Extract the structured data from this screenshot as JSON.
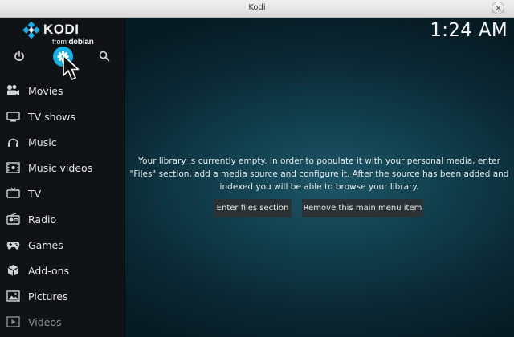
{
  "window": {
    "title": "Kodi"
  },
  "logo": {
    "name": "KODI",
    "from": "from",
    "distro": "debian"
  },
  "top_icons": [
    "power-icon",
    "settings-gear-icon",
    "search-icon"
  ],
  "clock": "1:24 AM",
  "menu": {
    "items": [
      {
        "label": "Movies",
        "icon": "movies-icon"
      },
      {
        "label": "TV shows",
        "icon": "tv-shows-icon"
      },
      {
        "label": "Music",
        "icon": "music-icon"
      },
      {
        "label": "Music videos",
        "icon": "music-videos-icon"
      },
      {
        "label": "TV",
        "icon": "tv-icon"
      },
      {
        "label": "Radio",
        "icon": "radio-icon"
      },
      {
        "label": "Games",
        "icon": "games-icon"
      },
      {
        "label": "Add-ons",
        "icon": "add-ons-icon"
      },
      {
        "label": "Pictures",
        "icon": "pictures-icon"
      },
      {
        "label": "Videos",
        "icon": "videos-icon"
      }
    ]
  },
  "main": {
    "message": "Your library is currently empty. In order to populate it with your personal media, enter \"Files\" section, add a media source and configure it. After the source has been added and indexed you will be able to browse your library.",
    "buttons": {
      "enter_files": "Enter files section",
      "remove_item": "Remove this main menu item"
    }
  },
  "colors": {
    "accent": "#12b2e7",
    "sidebar": "#101315",
    "background": "#12404f"
  }
}
